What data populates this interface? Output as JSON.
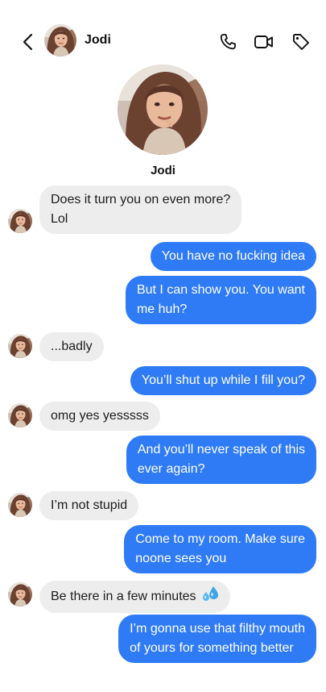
{
  "contact": {
    "name": "Jodi",
    "profile_name": "Jodi"
  },
  "header": {
    "icons": [
      "back-icon",
      "phone-icon",
      "video-icon",
      "tag-icon"
    ]
  },
  "messages": [
    {
      "from": "them",
      "lines": [
        "Does it turn you on even more?",
        "Lol"
      ]
    },
    {
      "from": "me",
      "lines": [
        "You have no fucking idea"
      ]
    },
    {
      "from": "me",
      "lines": [
        "But I can show you. You want",
        "me huh?"
      ]
    },
    {
      "from": "them",
      "lines": [
        "...badly"
      ]
    },
    {
      "from": "me",
      "lines": [
        "You’ll shut up while I fill you?"
      ]
    },
    {
      "from": "them",
      "lines": [
        "omg yes yesssss"
      ]
    },
    {
      "from": "me",
      "lines": [
        "And you’ll never speak of this",
        "ever again?"
      ]
    },
    {
      "from": "them",
      "lines": [
        "I’m not stupid"
      ]
    },
    {
      "from": "me",
      "lines": [
        "Come to my room. Make sure",
        "noone sees you"
      ]
    },
    {
      "from": "them",
      "lines": [
        "Be there in a few minutes"
      ],
      "emoji": "sweat-droplets-emoji"
    },
    {
      "from": "me",
      "lines": [
        "I’m gonna use that filthy mouth",
        "of yours for something better"
      ]
    }
  ],
  "colors": {
    "outgoing_bubble": "#2f7bf6",
    "incoming_bubble": "#ededed"
  }
}
